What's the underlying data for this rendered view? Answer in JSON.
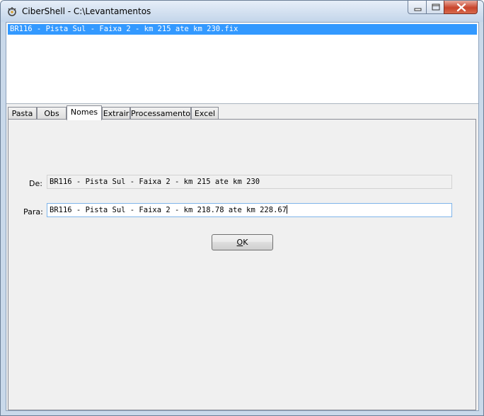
{
  "window": {
    "title": "CiberShell - C:\\Levantamentos",
    "icon": "gear-shell-icon",
    "controls": [
      "minimize-icon",
      "maximize-icon",
      "close-icon"
    ]
  },
  "file_list": {
    "items": [
      "BR116 - Pista Sul - Faixa 2 - km 215 ate km 230.fix"
    ],
    "selected_index": 0
  },
  "tabs": [
    {
      "label": "Pasta"
    },
    {
      "label": "Obs"
    },
    {
      "label": "Nomes",
      "active": true
    },
    {
      "label": "Extrair"
    },
    {
      "label": "Processamento"
    },
    {
      "label": "Excel"
    }
  ],
  "nomes": {
    "from_label": "De:",
    "from_value": "BR116 - Pista Sul - Faixa 2 - km 215 ate km 230",
    "to_label": "Para:",
    "to_value": "BR116 - Pista Sul - Faixa 2 - km 218.78 ate km 228.67",
    "ok_accel": "O",
    "ok_rest": "K"
  },
  "colors": {
    "selection": "#3399ff",
    "panel": "#f0f0f0",
    "frame": "#c9d9ea",
    "close_button": "#c8442c"
  }
}
